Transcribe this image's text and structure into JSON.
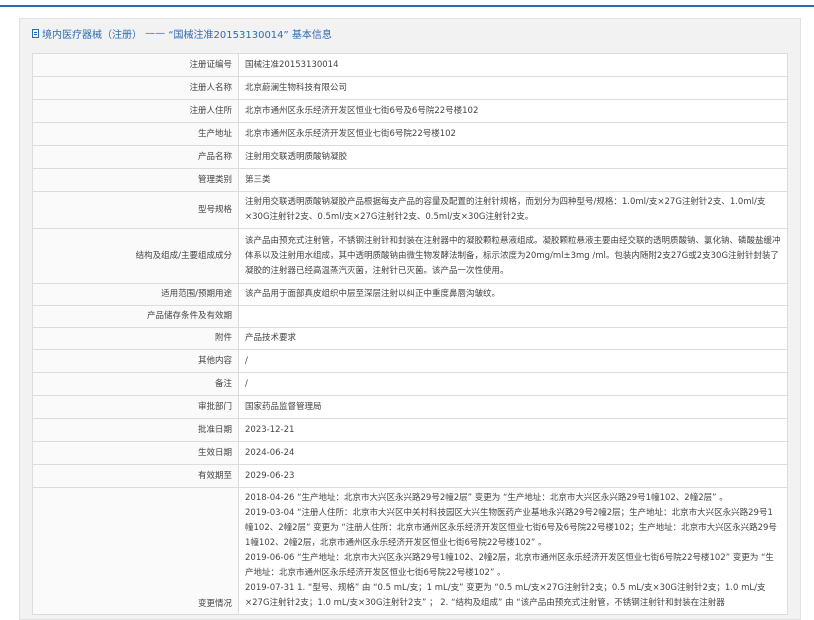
{
  "page": {
    "title_prefix": "境内医疗器械（注册）",
    "title_sep": " —— ",
    "title_main": "“国械注准20153130014” 基本信息"
  },
  "rows": [
    {
      "label": "注册证编号",
      "value": "国械注准20153130014"
    },
    {
      "label": "注册人名称",
      "value": "北京蔚澜生物科技有限公司"
    },
    {
      "label": "注册人住所",
      "value": "北京市通州区永乐经济开发区恒业七街6号及6号院22号楼102"
    },
    {
      "label": "生产地址",
      "value": "北京市通州区永乐经济开发区恒业七街6号院22号楼102"
    },
    {
      "label": "产品名称",
      "value": "注射用交联透明质酸钠凝胶"
    },
    {
      "label": "管理类别",
      "value": "第三类"
    },
    {
      "label": "型号规格",
      "value": "注射用交联透明质酸钠凝胶产品根据每支产品的容量及配置的注射针规格，而划分为四种型号/规格：1.0ml/支×27G注射针2支、1.0ml/支×30G注射针2支、0.5ml/支×27G注射针2支、0.5ml/支×30G注射针2支。"
    },
    {
      "label": "结构及组成/主要组成成分",
      "value": "该产品由预充式注射管，不锈钢注射针和封装在注射器中的凝胶颗粒悬液组成。凝胶颗粒悬液主要由经交联的透明质酸钠、氯化钠、磷酸盐缓冲体系以及注射用水组成，其中透明质酸钠由微生物发酵法制备，标示浓度为20mg/ml±3mg /ml。包装内随附2支27G或2支30G注射针封装了凝胶的注射器已经高温蒸汽灭菌，注射针已灭菌。该产品一次性使用。"
    },
    {
      "label": "适用范围/预期用途",
      "value": "该产品用于面部真皮组织中层至深层注射以纠正中重度鼻唇沟皱纹。"
    },
    {
      "label": "产品储存条件及有效期",
      "value": ""
    },
    {
      "label": "附件",
      "value": "产品技术要求"
    },
    {
      "label": "其他内容",
      "value": "/"
    },
    {
      "label": "备注",
      "value": "/"
    },
    {
      "label": "审批部门",
      "value": "国家药品监督管理局"
    },
    {
      "label": "批准日期",
      "value": "2023-12-21"
    },
    {
      "label": "生效日期",
      "value": "2024-06-24"
    },
    {
      "label": "有效期至",
      "value": "2029-06-23"
    }
  ],
  "history": {
    "label": "变更情况",
    "entries": [
      "2018-04-26 “生产地址：北京市大兴区永兴路29号2幢2层” 变更为 “生产地址：北京市大兴区永兴路29号1幢102、2幢2层” 。",
      "2019-03-04 “注册人住所：北京市大兴区中关村科技园区大兴生物医药产业基地永兴路29号2幢2层；生产地址：北京市大兴区永兴路29号1幢102、2幢2层” 变更为 “注册人住所：北京市通州区永乐经济开发区恒业七街6号及6号院22号楼102；生产地址：北京市大兴区永兴路29号1幢102、2幢2层，北京市通州区永乐经济开发区恒业七街6号院22号楼102” 。",
      "2019-06-06 “生产地址：北京市大兴区永兴路29号1幢102、2幢2层，北京市通州区永乐经济开发区恒业七街6号院22号楼102” 变更为 “生产地址：北京市通州区永乐经济开发区恒业七街6号院22号楼102” 。",
      "2019-07-31 1. “型号、规格” 由 “0.5 mL/支；1 mL/支” 变更为 “0.5 mL/支×27G注射针2支；0.5 mL/支×30G注射针2支；1.0 mL/支×27G注射针2支；1.0 mL/支×30G注射针2支” ； 2. “结构及组成” 由 “该产品由预充式注射管，不锈钢注射针和封装在注射器"
    ]
  }
}
